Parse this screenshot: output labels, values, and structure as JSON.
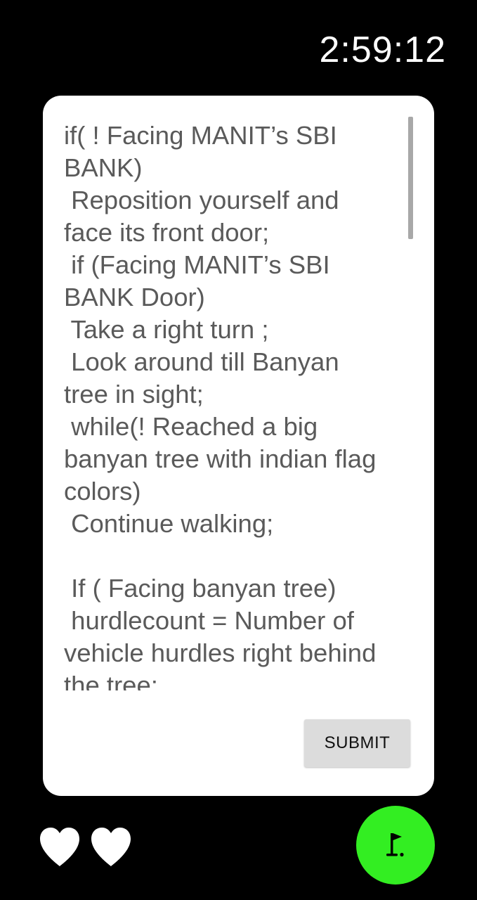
{
  "timer": "2:59:12",
  "clue_lines": [
    "if( ! Facing MANIT’s SBI",
    "BANK)",
    " Reposition yourself and",
    "face its front door;",
    " if (Facing MANIT’s SBI",
    "BANK Door)",
    " Take a right turn ;",
    " Look around till Banyan",
    "tree in sight;",
    " while(! Reached a big",
    "banyan tree with indian flag",
    "colors)",
    " Continue walking;",
    "",
    " If ( Facing banyan tree)",
    " hurdlecount = Number of",
    "vehicle hurdles right behind",
    "the tree;"
  ],
  "submit_label": "SUBMIT",
  "lives": {
    "count": 2,
    "icon": "heart-icon",
    "color": "#ffffff"
  },
  "fab": {
    "icon": "golf-flag-icon",
    "color": "#33ee22"
  }
}
